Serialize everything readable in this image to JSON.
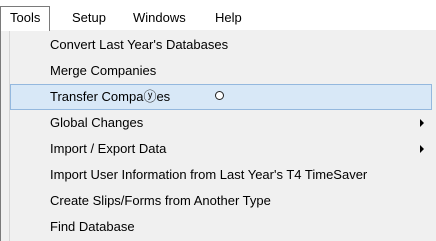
{
  "menubar": {
    "items": [
      {
        "label": "Tools",
        "active": true
      },
      {
        "label": "Setup",
        "active": false
      },
      {
        "label": "Windows",
        "active": false
      },
      {
        "label": "Help",
        "active": false
      }
    ]
  },
  "tools_menu": {
    "items": [
      {
        "label": "Convert Last Year's Databases",
        "submenu": false
      },
      {
        "label": "Merge Companies",
        "submenu": false
      },
      {
        "label": "Transfer Compaⓨes",
        "submenu": false,
        "highlighted": true
      },
      {
        "label": "Global Changes",
        "submenu": true
      },
      {
        "label": "Import / Export Data",
        "submenu": true
      },
      {
        "label": "Import User Information from Last Year's T4 TimeSaver",
        "submenu": false
      },
      {
        "label": "Create Slips/Forms from Another Type",
        "submenu": false
      },
      {
        "label": "Find Database",
        "submenu": false
      }
    ]
  }
}
